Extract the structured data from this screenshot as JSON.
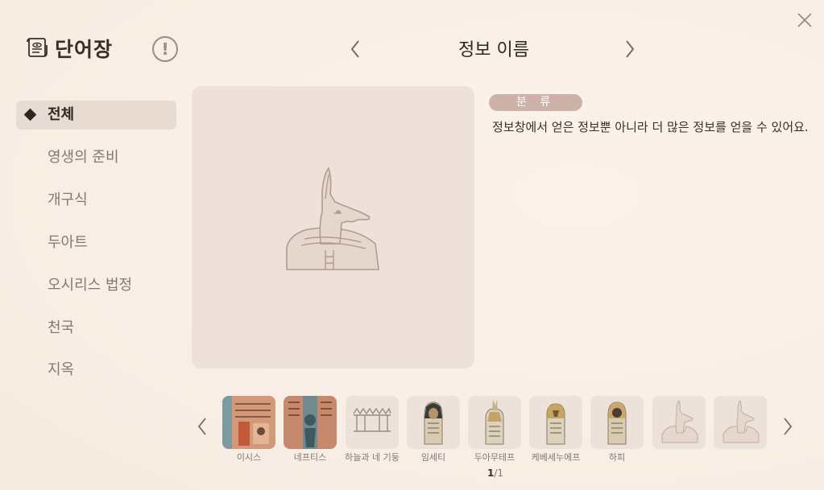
{
  "header": {
    "app_title": "단어장",
    "info_icon": "exclamation-circle-icon",
    "entry_title": "정보 이름",
    "close_icon": "close-icon"
  },
  "sidebar": {
    "items": [
      {
        "label": "전체",
        "active": true
      },
      {
        "label": "영생의 준비",
        "active": false
      },
      {
        "label": "개구식",
        "active": false
      },
      {
        "label": "두아트",
        "active": false
      },
      {
        "label": "오시리스 법정",
        "active": false
      },
      {
        "label": "천국",
        "active": false
      },
      {
        "label": "지옥",
        "active": false
      }
    ]
  },
  "detail": {
    "category_badge": "분 류",
    "description": "정보창에서 얻은 정보뿐 아니라 더 많은 정보를 얻을 수 있어요."
  },
  "thumbnails": {
    "items": [
      {
        "label": "이시스",
        "icon": "isis-painting"
      },
      {
        "label": "네프티스",
        "icon": "nephthys-painting"
      },
      {
        "label": "하늘과 네 기둥",
        "icon": "sky-pillars-icon"
      },
      {
        "label": "임세티",
        "icon": "canopic-jar-imsety"
      },
      {
        "label": "두아무테프",
        "icon": "canopic-jar-duamutef"
      },
      {
        "label": "케베세누에프",
        "icon": "canopic-jar-qebehsenuef"
      },
      {
        "label": "하피",
        "icon": "canopic-jar-hapi"
      },
      {
        "label": "",
        "icon": "anubis-placeholder-icon"
      },
      {
        "label": "",
        "icon": "anubis-placeholder-icon"
      }
    ],
    "page_current": "1",
    "page_separator": "/",
    "page_total": "1"
  },
  "colors": {
    "accent_badge": "#cdb2a9",
    "active_item_bg": "#e7dbd2",
    "panel_bg": "#ede1d9"
  }
}
